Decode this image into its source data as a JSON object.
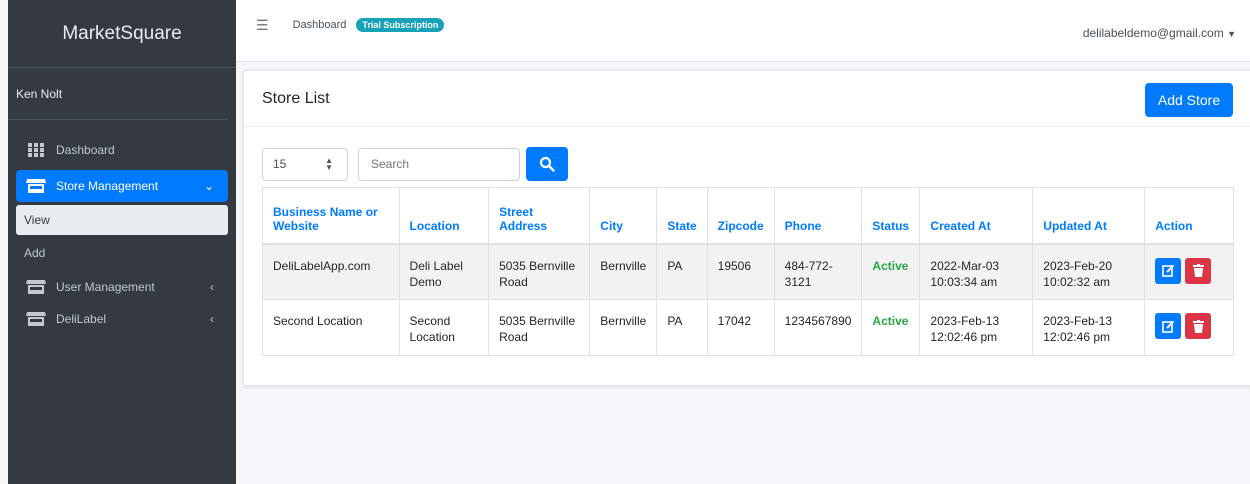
{
  "sidebar": {
    "brand": "MarketSquare",
    "user": "Ken Nolt",
    "items": [
      {
        "label": "Dashboard",
        "icon": "grid-icon"
      },
      {
        "label": "Store Management",
        "icon": "store-icon"
      },
      {
        "label": "View"
      },
      {
        "label": "Add"
      },
      {
        "label": "User Management",
        "icon": "store-icon"
      },
      {
        "label": "DeliLabel",
        "icon": "store-icon"
      }
    ]
  },
  "header": {
    "breadcrumb": "Dashboard",
    "badge": "Trial Subscription",
    "account": "delilabeldemo@gmail.com"
  },
  "card": {
    "title": "Store List",
    "add_label": "Add Store",
    "page_size": "15",
    "search_placeholder": "Search"
  },
  "table": {
    "headers": [
      "Business Name or Website",
      "Location",
      "Street Address",
      "City",
      "State",
      "Zipcode",
      "Phone",
      "Status",
      "Created At",
      "Updated At",
      "Action"
    ],
    "rows": [
      {
        "name": "DeliLabelApp.com",
        "location": "Deli Label Demo",
        "street": "5035 Bernville Road",
        "city": "Bernville",
        "state": "PA",
        "zip": "19506",
        "phone": "484-772-3121",
        "status": "Active",
        "created": "2022-Mar-03 10:03:34 am",
        "updated": "2023-Feb-20 10:02:32 am"
      },
      {
        "name": "Second Location",
        "location": "Second Location",
        "street": "5035 Bernville Road",
        "city": "Bernville",
        "state": "PA",
        "zip": "17042",
        "phone": "1234567890",
        "status": "Active",
        "created": "2023-Feb-13 12:02:46 pm",
        "updated": "2023-Feb-13 12:02:46 pm"
      }
    ]
  },
  "colors": {
    "primary": "#007bff",
    "danger": "#dc3545",
    "success": "#28a745",
    "info": "#17a2b8",
    "sidebar": "#343a40"
  }
}
